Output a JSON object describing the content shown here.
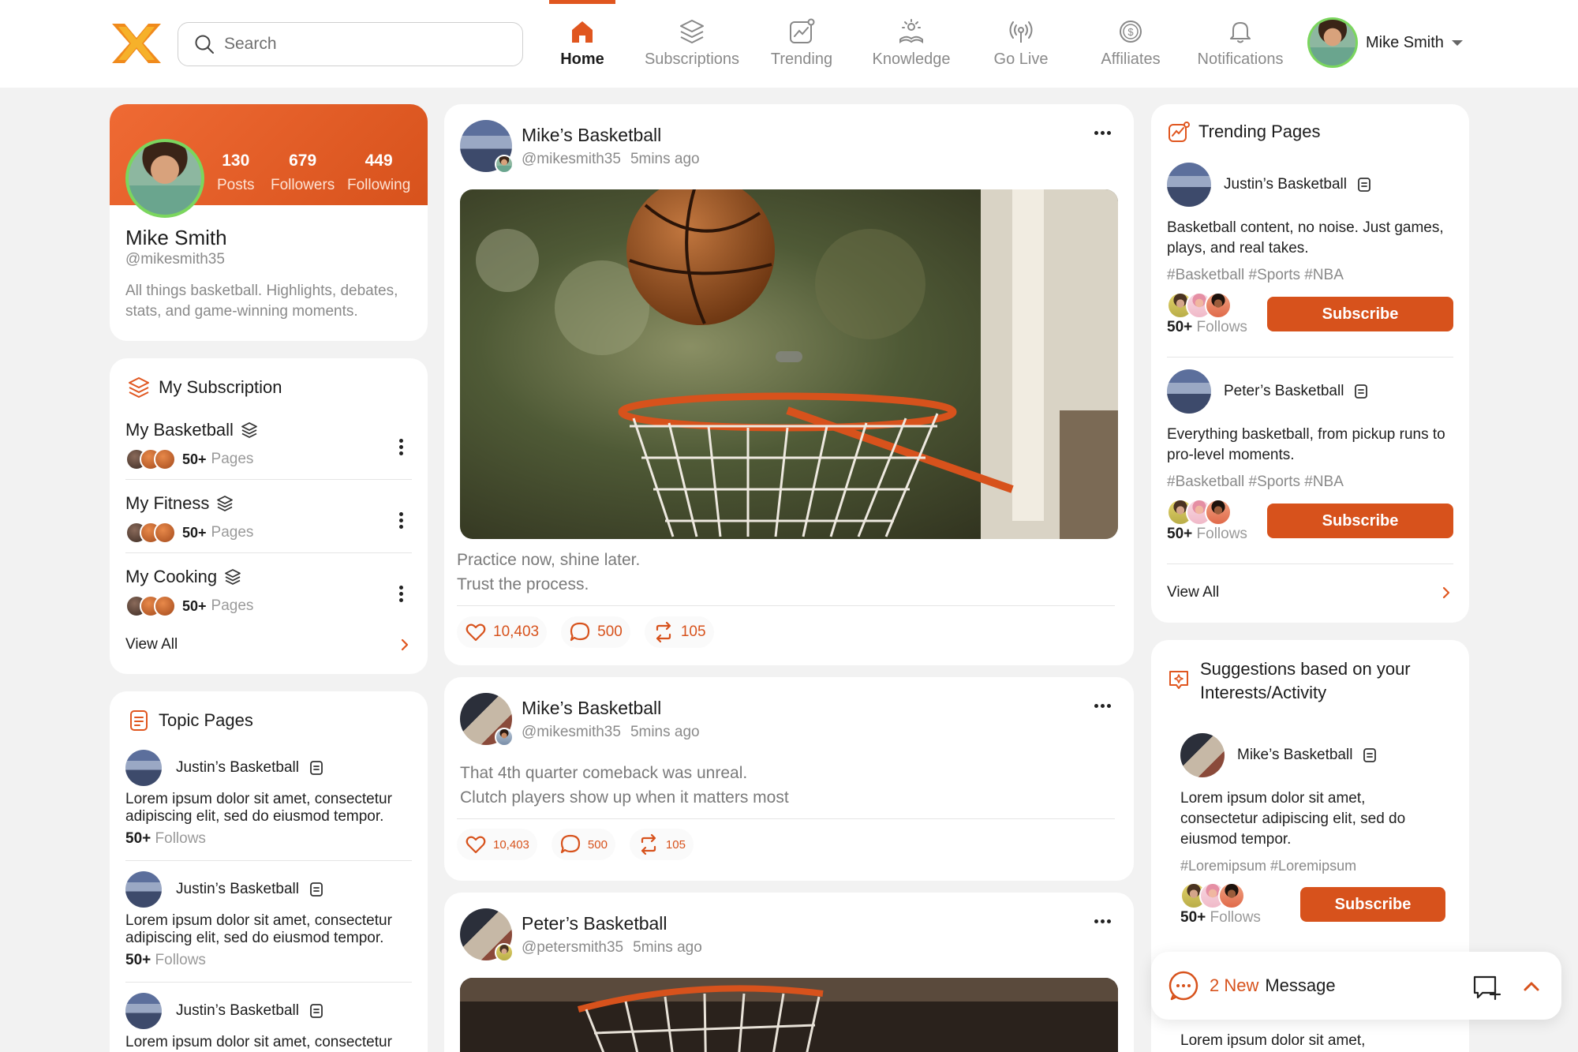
{
  "search": {
    "placeholder": "Search"
  },
  "nav": [
    {
      "label": "Home",
      "icon": "home-icon",
      "active": true
    },
    {
      "label": "Subscriptions",
      "icon": "layers-icon"
    },
    {
      "label": "Trending",
      "icon": "trending-icon"
    },
    {
      "label": "Knowledge",
      "icon": "knowledge-icon"
    },
    {
      "label": "Go Live",
      "icon": "broadcast-icon"
    },
    {
      "label": "Affiliates",
      "icon": "dollar-coin-icon"
    },
    {
      "label": "Notifications",
      "icon": "bell-icon"
    }
  ],
  "user": {
    "name": "Mike Smith"
  },
  "profile": {
    "posts": "130",
    "posts_label": "Posts",
    "followers": "679",
    "followers_label": "Followers",
    "following": "449",
    "following_label": "Following",
    "name": "Mike Smith",
    "handle": "@mikesmith35",
    "bio": "All things basketball. Highlights, debates, stats, and game-winning moments."
  },
  "subscriptions": {
    "title": "My Subscription",
    "items": [
      {
        "name": "My Basketball",
        "count": "50+",
        "unit": "Pages"
      },
      {
        "name": "My Fitness",
        "count": "50+",
        "unit": "Pages"
      },
      {
        "name": "My Cooking",
        "count": "50+",
        "unit": "Pages"
      }
    ],
    "view_all": "View All"
  },
  "topic_pages": {
    "title": "Topic Pages",
    "items": [
      {
        "name": "Justin’s Basketball",
        "desc": "Lorem ipsum dolor sit amet, consectetur adipiscing elit, sed do eiusmod tempor.",
        "count": "50+",
        "unit": "Follows"
      },
      {
        "name": "Justin’s Basketball",
        "desc": "Lorem ipsum dolor sit amet, consectetur adipiscing elit, sed do eiusmod tempor.",
        "count": "50+",
        "unit": "Follows"
      },
      {
        "name": "Justin’s Basketball",
        "desc": "Lorem ipsum dolor sit amet, consectetur"
      }
    ]
  },
  "posts": [
    {
      "author": "Mike’s Basketball",
      "handle": "@mikesmith35",
      "time": "5mins ago",
      "text1": "Practice now, shine later.",
      "text2": "Trust the process.",
      "likes": "10,403",
      "comments": "500",
      "reposts": "105"
    },
    {
      "author": "Mike’s Basketball",
      "handle": "@mikesmith35",
      "time": "5mins ago",
      "text1": "That 4th quarter comeback was unreal.",
      "text2": "Clutch players show up when it matters most",
      "likes": "10,403",
      "comments": "500",
      "reposts": "105"
    },
    {
      "author": "Peter’s Basketball",
      "handle": "@petersmith35",
      "time": "5mins ago"
    }
  ],
  "trending": {
    "title": "Trending Pages",
    "items": [
      {
        "name": "Justin’s Basketball",
        "desc": "Basketball content, no noise. Just games, plays, and real takes.",
        "tags": "#Basketball #Sports #NBA",
        "count": "50+",
        "unit": "Follows",
        "button": "Subscribe"
      },
      {
        "name": "Peter’s Basketball",
        "desc": "Everything basketball, from pickup runs to pro-level moments.",
        "tags": "#Basketball #Sports #NBA",
        "count": "50+",
        "unit": "Follows",
        "button": "Subscribe"
      }
    ],
    "view_all": "View All"
  },
  "suggestions": {
    "title": "Suggestions based on your Interests/Activity",
    "item": {
      "name": "Mike’s Basketball",
      "desc": "Lorem ipsum dolor sit amet, consectetur adipiscing elit, sed do eiusmod tempor.",
      "tags": "#Loremipsum  #Loremipsum",
      "count": "50+",
      "unit": "Follows",
      "button": "Subscribe"
    },
    "peek": "Lorem ipsum dolor sit amet,"
  },
  "messages": {
    "new": "2 New",
    "label": "Message"
  },
  "colors": {
    "accent": "#d7521c",
    "accent_light": "#ef6a34",
    "avatar_ring": "#7bd65e"
  }
}
